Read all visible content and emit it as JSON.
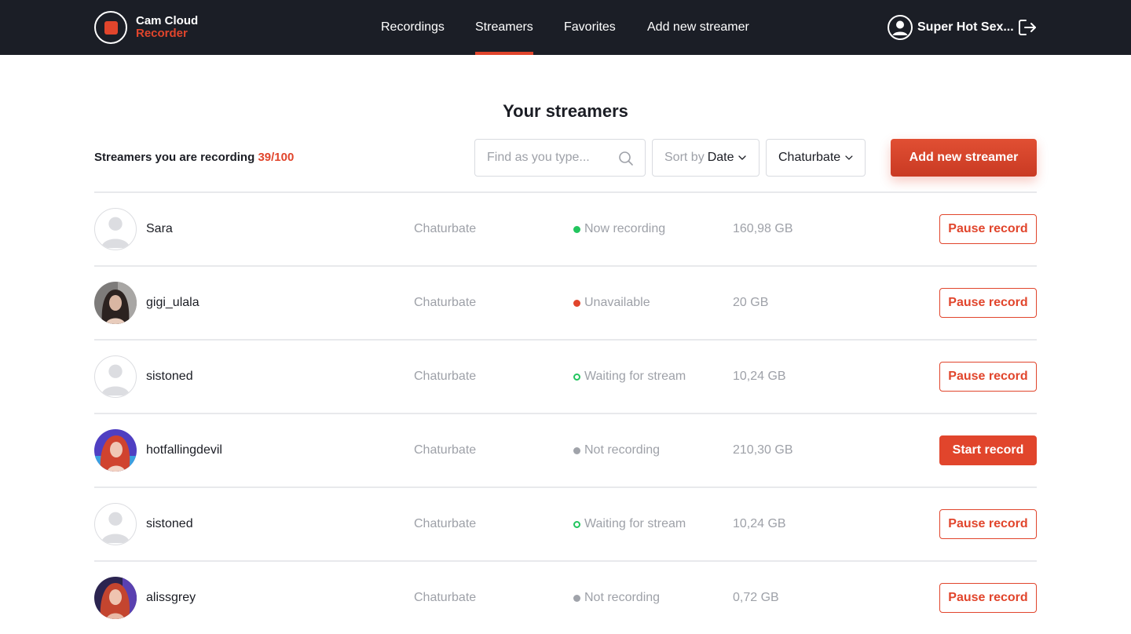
{
  "header": {
    "logo_line1": "Cam Cloud",
    "logo_line2": "Recorder",
    "nav": [
      {
        "label": "Recordings",
        "active": false
      },
      {
        "label": "Streamers",
        "active": true
      },
      {
        "label": "Favorites",
        "active": false
      },
      {
        "label": "Add new streamer",
        "active": false
      }
    ],
    "user_name": "Super Hot Sex..."
  },
  "page": {
    "title": "Your streamers",
    "counter_label": "Streamers you are recording",
    "counter_value": "39/100",
    "search_placeholder": "Find as you type...",
    "sort_prefix": "Sort by",
    "sort_value": "Date",
    "platform_filter": "Chaturbate",
    "add_button": "Add new streamer"
  },
  "colors": {
    "accent": "#e1452c",
    "header_bg": "#1b1e26",
    "status_recording": "#22c55e",
    "status_unavailable": "#e1452c",
    "status_waiting": "#22c55e",
    "status_not_recording": "#a0a3aa"
  },
  "streamers": [
    {
      "name": "Sara",
      "platform": "Chaturbate",
      "status": "Now recording",
      "status_type": "recording",
      "size": "160,98 GB",
      "action": "Pause record",
      "action_type": "outline",
      "avatar": "placeholder"
    },
    {
      "name": "gigi_ulala",
      "platform": "Chaturbate",
      "status": "Unavailable",
      "status_type": "unavailable",
      "size": "20 GB",
      "action": "Pause record",
      "action_type": "outline",
      "avatar": "photo-dark-hair"
    },
    {
      "name": "sistoned",
      "platform": "Chaturbate",
      "status": "Waiting for stream",
      "status_type": "waiting",
      "size": "10,24 GB",
      "action": "Pause record",
      "action_type": "outline",
      "avatar": "placeholder"
    },
    {
      "name": "hotfallingdevil",
      "platform": "Chaturbate",
      "status": "Not recording",
      "status_type": "not-recording",
      "size": "210,30 GB",
      "action": "Start record",
      "action_type": "solid",
      "avatar": "photo-red-hair"
    },
    {
      "name": "sistoned",
      "platform": "Chaturbate",
      "status": "Waiting for stream",
      "status_type": "waiting",
      "size": "10,24 GB",
      "action": "Pause record",
      "action_type": "outline",
      "avatar": "placeholder"
    },
    {
      "name": "alissgrey",
      "platform": "Chaturbate",
      "status": "Not recording",
      "status_type": "not-recording",
      "size": "0,72 GB",
      "action": "Pause record",
      "action_type": "outline",
      "avatar": "photo-red-hair-purple"
    }
  ]
}
